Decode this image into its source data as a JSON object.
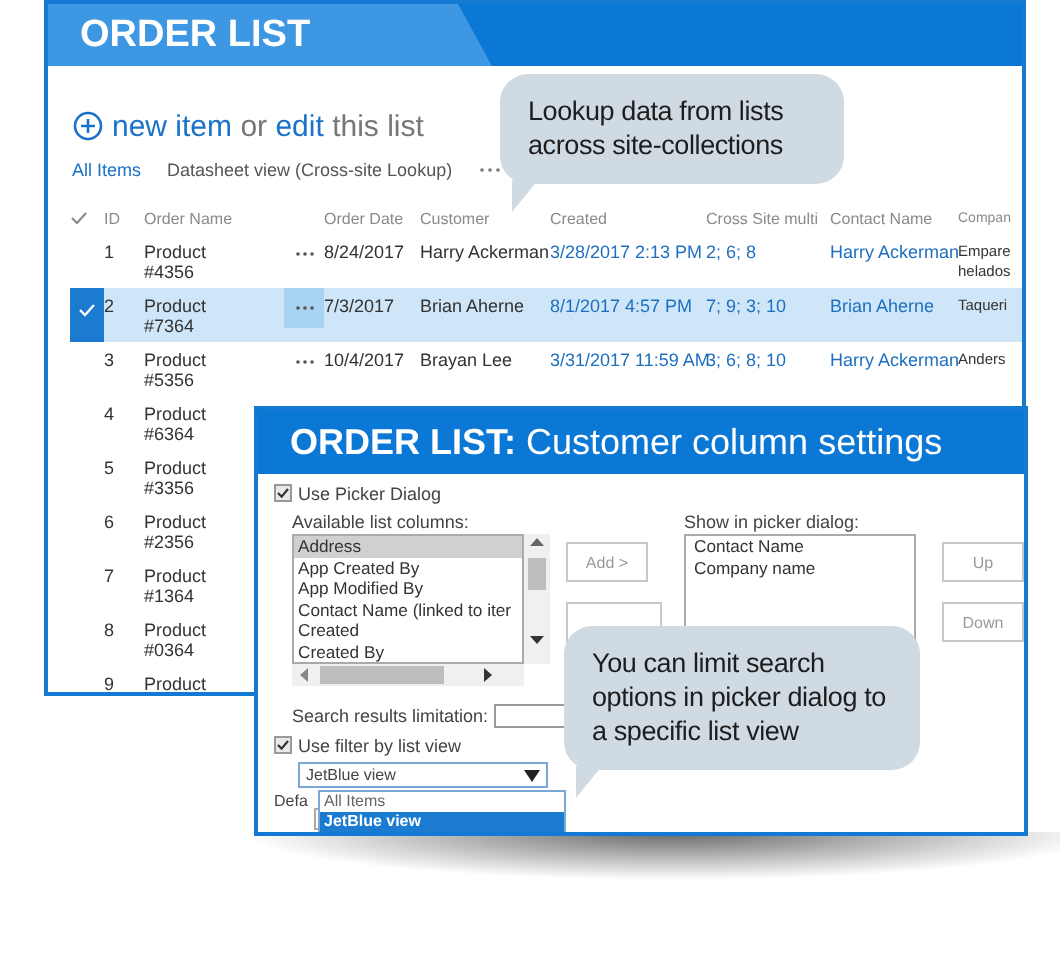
{
  "list_window": {
    "title": "ORDER LIST",
    "actions": {
      "new_link": "new item",
      "middle": "or",
      "edit_link": "edit",
      "tail": "this list"
    },
    "views": [
      {
        "label": "All Items",
        "selected": true
      },
      {
        "label": "Datasheet view (Cross-site Lookup)",
        "selected": false
      }
    ],
    "columns": [
      "ID",
      "Order Name",
      "Order Date",
      "Customer",
      "Created",
      "Cross Site multi",
      "Contact Name",
      "Compan"
    ],
    "rows": [
      {
        "id": "1",
        "order_name": "Product #4356",
        "order_date": "8/24/2017",
        "customer": "Harry Ackerman",
        "created": "3/28/2017 2:13 PM",
        "cross_site": "2; 6; 8",
        "contact": "Harry Ackerman",
        "company": "Empare helados",
        "selected": false
      },
      {
        "id": "2",
        "order_name": "Product #7364",
        "order_date": "7/3/2017",
        "customer": "Brian Aherne",
        "created": "8/1/2017 4:57 PM",
        "cross_site": "7; 9; 3; 10",
        "contact": "Brian Aherne",
        "company": "Taqueri",
        "selected": true
      },
      {
        "id": "3",
        "order_name": "Product #5356",
        "order_date": "10/4/2017",
        "customer": "Brayan Lee",
        "created": "3/31/2017 11:59 AM",
        "cross_site": "3; 6; 8; 10",
        "contact": "Harry Ackerman",
        "company": "Anders",
        "selected": false
      },
      {
        "id": "4",
        "order_name": "Product #6364",
        "selected": false
      },
      {
        "id": "5",
        "order_name": "Product #3356",
        "selected": false
      },
      {
        "id": "6",
        "order_name": "Product #2356",
        "selected": false
      },
      {
        "id": "7",
        "order_name": "Product #1364",
        "selected": false
      },
      {
        "id": "8",
        "order_name": "Product #0364",
        "selected": false
      },
      {
        "id": "9",
        "order_name": "Product",
        "selected": false
      }
    ]
  },
  "settings_dialog": {
    "title": "**ORDER LIST:** Customer column settings",
    "use_picker": {
      "label": "Use Picker Dialog",
      "checked": true
    },
    "available_label": "Available list columns:",
    "available_columns": [
      {
        "label": "Address",
        "selected": true
      },
      {
        "label": "App Created By",
        "selected": false
      },
      {
        "label": "App Modified By",
        "selected": false
      },
      {
        "label": "Contact Name (linked to iter",
        "selected": false
      },
      {
        "label": "Created",
        "selected": false
      },
      {
        "label": "Created By",
        "selected": false
      }
    ],
    "add_button": "Add >",
    "show_label": "Show in picker dialog:",
    "show_columns": [
      "Contact Name",
      "Company name"
    ],
    "up_button": "Up",
    "down_button": "Down",
    "search_limit_label": "Search results limitation:",
    "use_filter": {
      "label": "Use filter by list view",
      "checked": true
    },
    "view_dropdown": {
      "value": "JetBlue view",
      "options": [
        {
          "label": "All Items",
          "selected": false
        },
        {
          "label": "JetBlue view",
          "selected": true
        }
      ]
    },
    "default_label": "Defa"
  },
  "callouts": [
    {
      "text": "Lookup data from lists across site-collections"
    },
    {
      "text": "You can limit search options in picker dialog to a specific list view"
    }
  ]
}
